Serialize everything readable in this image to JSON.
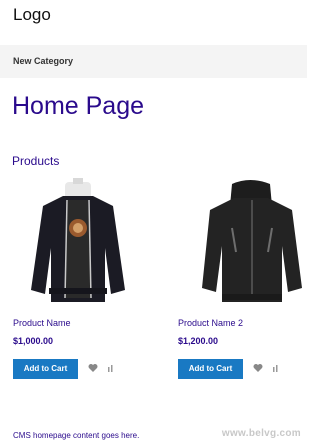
{
  "header": {
    "logo": "Logo"
  },
  "nav": {
    "items": [
      "New Category"
    ]
  },
  "main": {
    "page_title": "Home Page",
    "section_title": "Products",
    "products": [
      {
        "name": "Product Name",
        "price": "$1,000.00",
        "button": "Add to Cart",
        "image": "jacket-hooded-black"
      },
      {
        "name": "Product Name 2",
        "price": "$1,200.00",
        "button": "Add to Cart",
        "image": "softshell-jacket-black"
      }
    ]
  },
  "footer": {
    "text": "CMS homepage content goes here."
  },
  "watermark": "www.belvg.com",
  "colors": {
    "primary_link": "#2a0a8c",
    "button": "#1979c3",
    "nav_bg": "#f4f4f4"
  }
}
